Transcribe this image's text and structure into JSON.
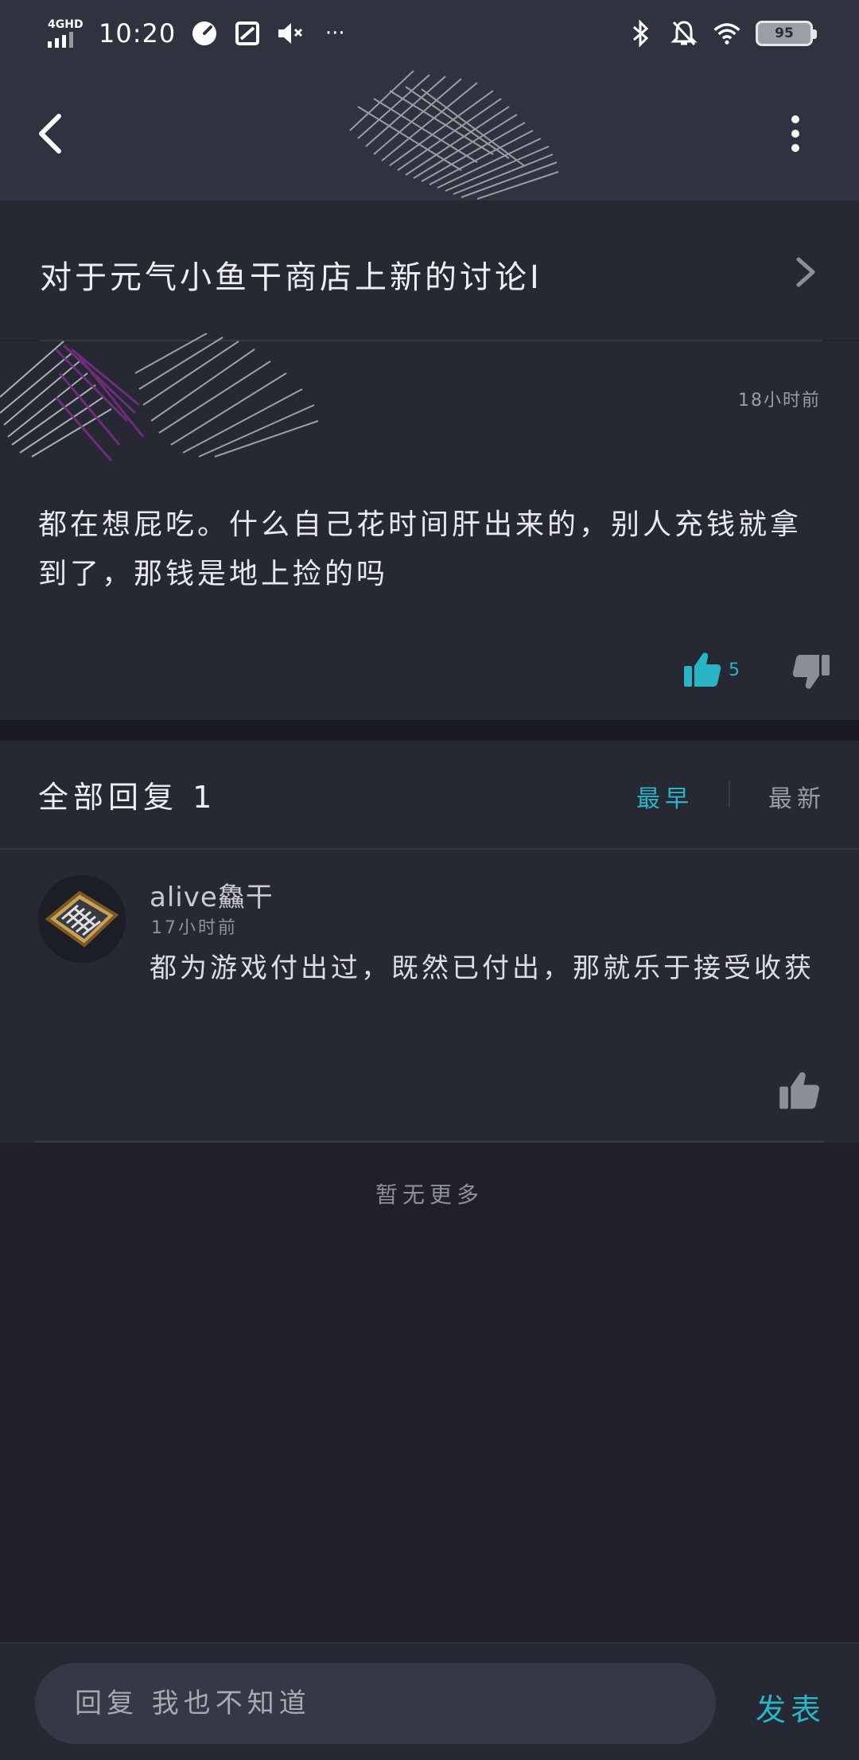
{
  "status_bar": {
    "network": "4GHD",
    "time": "10:20",
    "battery": "95",
    "more": "···"
  },
  "topic": {
    "title": "对于元气小鱼干商店上新的讨论Ⅰ"
  },
  "post": {
    "time": "18小时前",
    "body": "都在想屁吃。什么自己花时间肝出来的，别人充钱就拿到了，那钱是地上捡的吗",
    "like_count": "5"
  },
  "replies": {
    "title": "全部回复 1",
    "sort_earliest": "最早",
    "sort_latest": "最新",
    "items": [
      {
        "name": "alive鱻干",
        "time": "17小时前",
        "body": "都为游戏付出过，既然已付出，那就乐于接受收获"
      }
    ],
    "no_more": "暂无更多"
  },
  "bottom_bar": {
    "placeholder": "回复 我也不知道",
    "publish_label": "发表"
  },
  "colors": {
    "accent": "#2ab5c7",
    "header_bg": "#2f3340",
    "card_bg": "#262833",
    "page_bg": "#1f2029"
  }
}
